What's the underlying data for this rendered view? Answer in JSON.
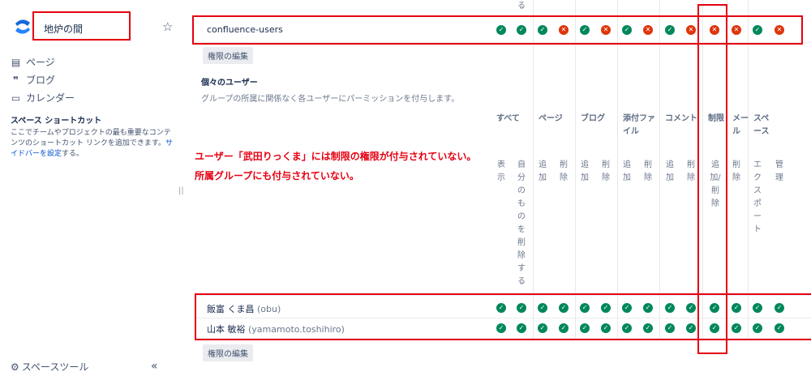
{
  "sidebar": {
    "space_title": "地炉の間",
    "nav": [
      {
        "label": "ページ",
        "icon": "page-icon"
      },
      {
        "label": "ブログ",
        "icon": "blog-quote-icon"
      },
      {
        "label": "カレンダー",
        "icon": "calendar-icon"
      }
    ],
    "shortcut_heading": "スペース ショートカット",
    "shortcut_desc": "ここでチームやプロジェクトの最も重要なコンテンツのショートカット リンクを追加できます。",
    "shortcut_link": "サイドバーを設定",
    "shortcut_tail": "する。",
    "space_tools": "スペースツール",
    "collapse": "«",
    "resize": "||"
  },
  "groups_section": {
    "top_fragment": "る",
    "group_name": "confluence-users",
    "group_perms": [
      "check",
      "check",
      "check",
      "cross",
      "check",
      "cross",
      "check",
      "cross",
      "check",
      "cross",
      "cross",
      "cross",
      "check",
      "cross"
    ],
    "edit_button": "権限の編集"
  },
  "individuals": {
    "heading": "個々のユーザー",
    "description": "グループの所属に関係なく各ユーザーにパーミッションを付与します。",
    "col_groups": [
      {
        "label": "すべて"
      },
      {
        "label": "ページ"
      },
      {
        "label": "ブログ"
      },
      {
        "label": "添付ファイル"
      },
      {
        "label": "コメント"
      },
      {
        "label": "制限"
      },
      {
        "label": "メール"
      },
      {
        "label": "スペース"
      }
    ],
    "sub_cols": [
      "表示",
      "自分のものを削除する",
      "追加",
      "削除",
      "追加",
      "削除",
      "追加",
      "削除",
      "追加",
      "削除",
      "追加/削除",
      "削除",
      "エクスポート",
      "管理"
    ],
    "users": [
      {
        "name": "飯富 くま昌",
        "id": "(obu)",
        "perms": [
          "check",
          "check",
          "check",
          "check",
          "check",
          "check",
          "check",
          "check",
          "check",
          "check",
          "check",
          "check",
          "check",
          "check"
        ]
      },
      {
        "name": "山本 敏裕",
        "id": "(yamamoto.toshihiro)",
        "perms": [
          "check",
          "check",
          "check",
          "check",
          "check",
          "check",
          "check",
          "check",
          "check",
          "check",
          "check",
          "check",
          "check",
          "check"
        ]
      }
    ],
    "edit_button": "権限の編集"
  },
  "annotations": {
    "line1": "ユーザー「武田りっくま」には制限の権限が付与されていない。",
    "line2": "所属グループにも付与されていない。"
  },
  "colors": {
    "check": "#00875a",
    "cross": "#de350b",
    "highlight": "#e60012"
  }
}
